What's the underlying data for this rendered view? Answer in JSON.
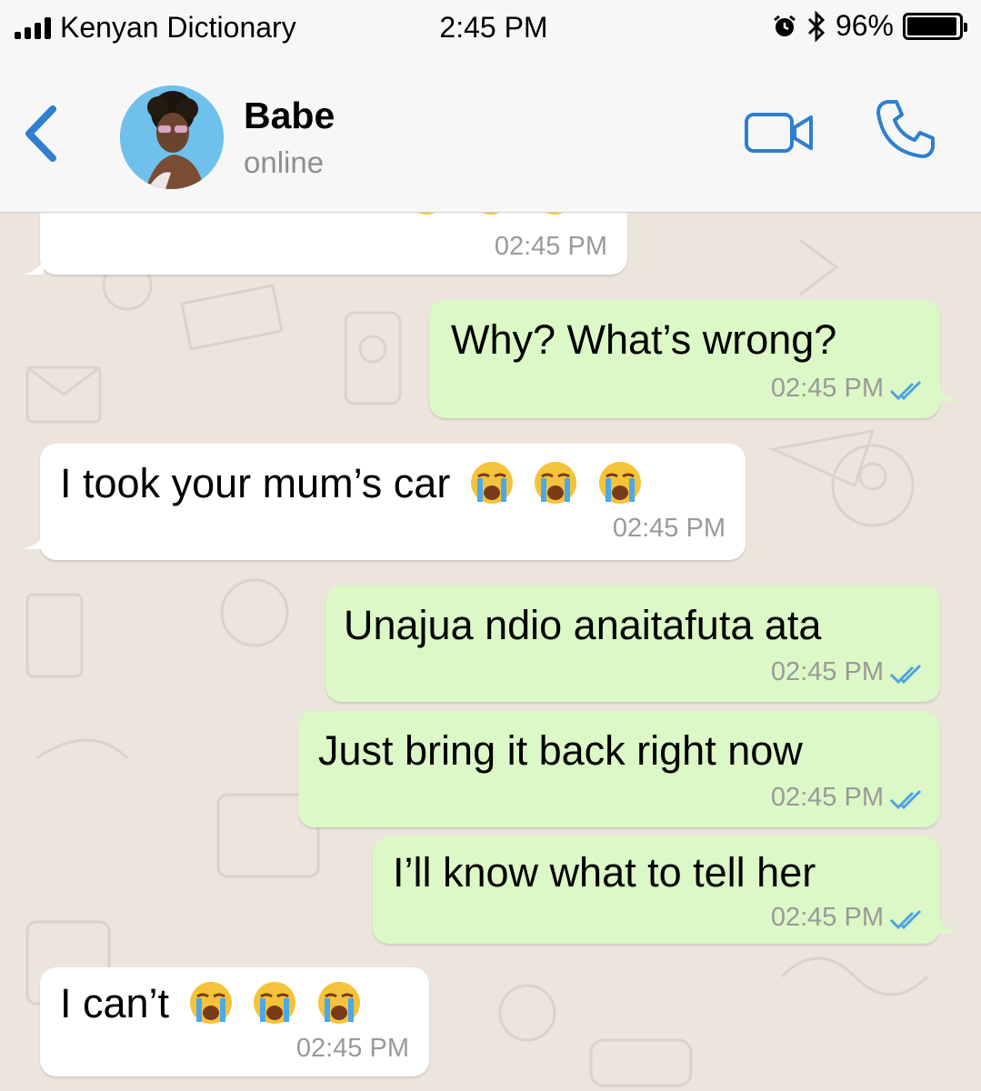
{
  "status_bar": {
    "carrier": "Kenyan Dictionary",
    "time": "2:45 PM",
    "battery": "96%",
    "battery_level": 0.96,
    "icons": [
      "signal-icon",
      "alarm-icon",
      "bluetooth-icon",
      "battery-icon"
    ]
  },
  "header": {
    "name": "Babe",
    "status": "online",
    "icons": [
      "back-chevron-icon",
      "avatar",
      "video-call-icon",
      "phone-icon"
    ],
    "accent": "#2f7fd0"
  },
  "messages": [
    {
      "direction": "in",
      "text": "",
      "emoji": [
        "crying-face",
        "crying-face",
        "crying-face"
      ],
      "time": "02:45 PM",
      "note": "partially scrolled off top"
    },
    {
      "direction": "out",
      "text": "Why? What’s wrong?",
      "time": "02:45 PM",
      "read": true
    },
    {
      "direction": "in",
      "text": "I took your mum’s car",
      "emoji": [
        "crying-face",
        "crying-face",
        "crying-face"
      ],
      "time": "02:45 PM"
    },
    {
      "direction": "out",
      "text": "Unajua ndio anaitafuta ata",
      "time": "02:45 PM",
      "read": true
    },
    {
      "direction": "out",
      "text": "Just bring it back right now",
      "time": "02:45 PM",
      "read": true
    },
    {
      "direction": "out",
      "text": "I’ll know what to tell her",
      "time": "02:45 PM",
      "read": true
    },
    {
      "direction": "in",
      "text": "I can’t",
      "emoji": [
        "crying-face",
        "crying-face",
        "crying-face"
      ],
      "time": "02:45 PM"
    }
  ],
  "colors": {
    "incoming_bubble": "#ffffff",
    "outgoing_bubble": "#dcf8c6",
    "wallpaper": "#ece5dd",
    "read_ticks": "#4fa3e0"
  }
}
